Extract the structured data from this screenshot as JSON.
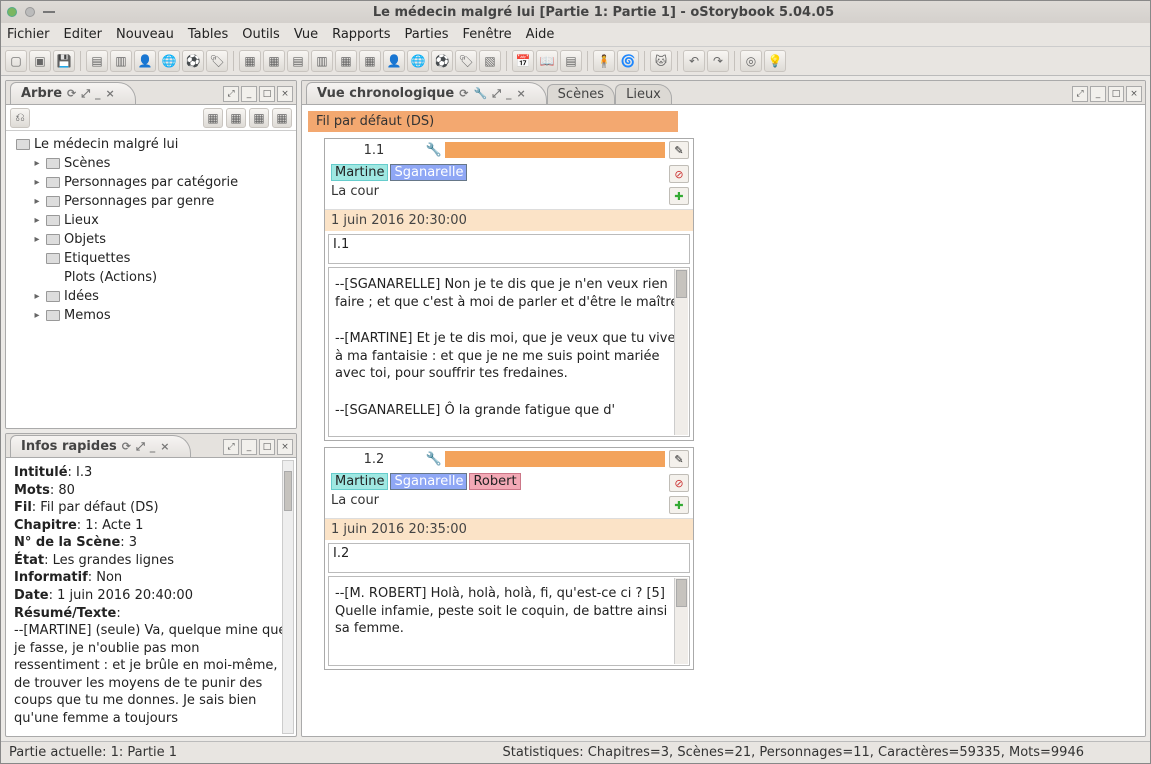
{
  "window": {
    "title": "Le médecin malgré lui [Partie 1: Partie 1] - oStorybook 5.04.05"
  },
  "menu": [
    "Fichier",
    "Editer",
    "Nouveau",
    "Tables",
    "Outils",
    "Vue",
    "Rapports",
    "Parties",
    "Fenêtre",
    "Aide"
  ],
  "tree_panel": {
    "title": "Arbre"
  },
  "tree": {
    "root": "Le médecin malgré lui",
    "items": [
      "Scènes",
      "Personnages par catégorie",
      "Personnages par genre",
      "Lieux",
      "Objets",
      "Etiquettes",
      "Plots (Actions)",
      "Idées",
      "Memos"
    ]
  },
  "info_panel": {
    "title": "Infos rapides"
  },
  "info": {
    "l1": "Intitulé",
    "v1": ": I.3",
    "l2": "Mots",
    "v2": ": 80",
    "l3": "Fil",
    "v3": ": Fil par défaut (DS)",
    "l4": "Chapitre",
    "v4": ": 1: Acte 1",
    "l5": "N° de la Scène",
    "v5": ": 3",
    "l6": "État",
    "v6": ": Les grandes lignes",
    "l7": "Informatif",
    "v7": ": Non",
    "l8": "Date",
    "v8": ": 1 juin 2016 20:40:00",
    "l9": "Résumé/Texte",
    "v9": ":",
    "body": "--[MARTINE] (seule) Va, quelque mine que je fasse, je n'oublie pas mon ressentiment : et je brûle en moi-même, de trouver les moyens de te punir des coups que tu me donnes. Je sais bien qu'une femme a toujours"
  },
  "chrono": {
    "title": "Vue chronologique",
    "tab_scenes": "Scènes",
    "tab_lieux": "Lieux",
    "strand": "Fil par défaut (DS)"
  },
  "scene1": {
    "num": "1.1",
    "chars": {
      "a": "Martine",
      "b": "Sganarelle"
    },
    "loc": "La cour",
    "date": "1 juin 2016 20:30:00",
    "summary": "I.1",
    "text_p1": "--[SGANARELLE] Non je te dis que je n'en veux rien faire ; et que c'est à moi de parler et d'être le maître.",
    "text_p2": "--[MARTINE] Et je te dis moi, que je veux que tu vives à ma fantaisie : et que je ne me suis point mariée avec toi, pour souffrir tes fredaines.",
    "text_p3": "--[SGANARELLE] Ô la grande fatigue que d'"
  },
  "scene2": {
    "num": "1.2",
    "chars": {
      "a": "Martine",
      "b": "Sganarelle",
      "c": "Robert"
    },
    "loc": "La cour",
    "date": "1 juin 2016 20:35:00",
    "summary": "I.2",
    "text_p1": "--[M. ROBERT] Holà, holà, holà, fi, qu'est-ce ci ? [5] Quelle infamie, peste soit le coquin, de battre ainsi sa femme."
  },
  "status": {
    "left": "Partie actuelle: 1: Partie 1",
    "right": "Statistiques: Chapitres=3,  Scènes=21,  Personnages=11,  Caractères=59335,  Mots=9946"
  }
}
